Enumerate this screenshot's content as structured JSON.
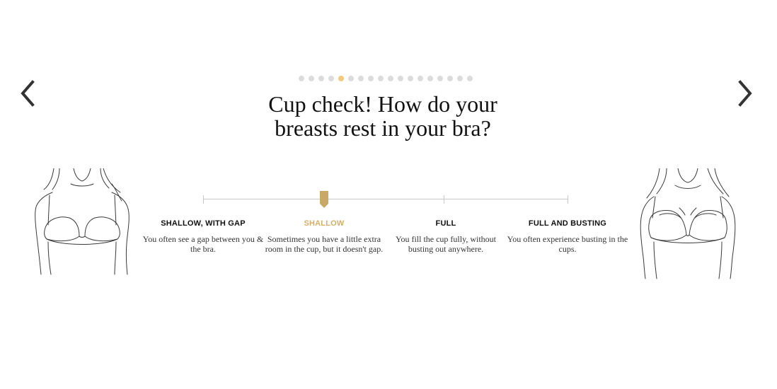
{
  "title": "Cup check! How do your breasts rest in your bra?",
  "navigation": {
    "prev_icon": "chevron-left-icon",
    "next_icon": "chevron-right-icon"
  },
  "progress": {
    "total_steps": 18,
    "current_step": 5
  },
  "slider": {
    "selected_index": 1,
    "options": [
      {
        "label": "SHALLOW, WITH GAP",
        "description": "You often see a gap between you & the bra."
      },
      {
        "label": "SHALLOW",
        "description": "Sometimes you have a little extra room in the cup, but it doesn't gap."
      },
      {
        "label": "FULL",
        "description": "You fill the cup fully, without busting out anywhere."
      },
      {
        "label": "FULL AND BUSTING",
        "description": "You often experience busting in the cups."
      }
    ]
  },
  "colors": {
    "accent": "#d2b06b",
    "dot_active": "#f2c97f",
    "dot_inactive": "#dcdcdc",
    "track": "#c8c8c8",
    "handle": "#c9a968"
  },
  "illustrations": {
    "left": "bra-shallow-illustration",
    "right": "bra-full-illustration"
  }
}
